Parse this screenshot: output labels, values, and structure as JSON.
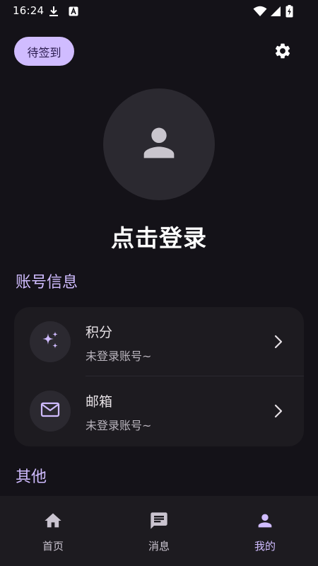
{
  "status_bar": {
    "time": "16:24",
    "icons": [
      "download-icon",
      "app-notification-icon",
      "wifi-icon",
      "signal-icon",
      "battery-charging-icon"
    ]
  },
  "header": {
    "checkin_label": "待签到",
    "settings_icon": "gear-icon"
  },
  "profile": {
    "avatar_icon": "person-icon",
    "login_label": "点击登录"
  },
  "account_section": {
    "title": "账号信息",
    "items": [
      {
        "icon": "sparkle-icon",
        "title": "积分",
        "subtitle": "未登录账号~"
      },
      {
        "icon": "mail-icon",
        "title": "邮箱",
        "subtitle": "未登录账号~"
      }
    ]
  },
  "other_section": {
    "title": "其他"
  },
  "bottom_nav": {
    "items": [
      {
        "icon": "home-icon",
        "label": "首页",
        "active": false
      },
      {
        "icon": "message-icon",
        "label": "消息",
        "active": false
      },
      {
        "icon": "person-icon",
        "label": "我的",
        "active": true
      }
    ]
  },
  "colors": {
    "background": "#141218",
    "accent": "#D0BCFF",
    "surface": "#1D1B20",
    "surface_high": "#2B2930"
  }
}
